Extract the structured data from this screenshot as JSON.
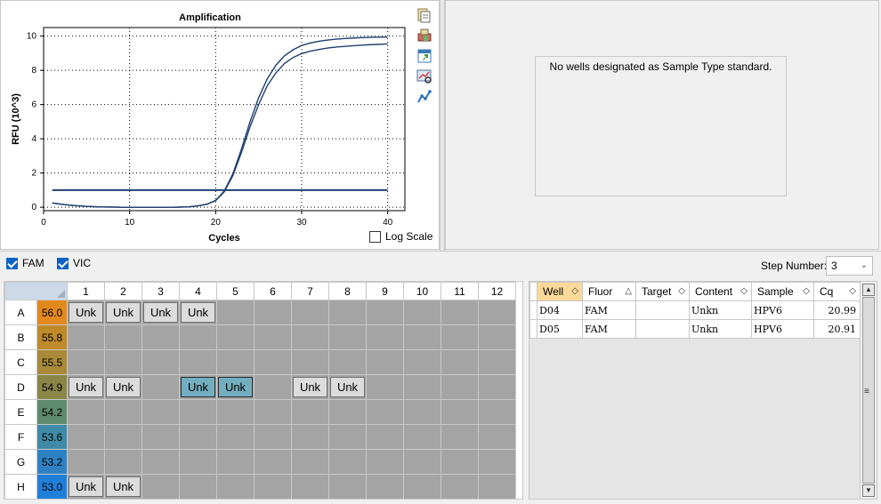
{
  "chart": {
    "toolbar_icons": [
      "copy-icon",
      "print-icon",
      "export-icon",
      "zoom-icon",
      "graph-settings-icon"
    ],
    "log_scale_label": "Log Scale",
    "log_scale_checked": false
  },
  "chart_data": {
    "type": "line",
    "title": "Amplification",
    "xlabel": "Cycles",
    "ylabel": "RFU (10^3)",
    "xlim": [
      0,
      42
    ],
    "ylim": [
      -0.2,
      10.5
    ],
    "xticks": [
      0,
      10,
      20,
      30,
      40
    ],
    "yticks": [
      0,
      2,
      4,
      6,
      8,
      10
    ],
    "grid": true,
    "line_color": "#1f3f70",
    "threshold": 1.0,
    "series": [
      {
        "well": "D04",
        "x": [
          1,
          2,
          3,
          4,
          5,
          6,
          7,
          8,
          9,
          10,
          11,
          12,
          13,
          14,
          15,
          16,
          17,
          18,
          19,
          20,
          21,
          22,
          23,
          24,
          25,
          26,
          27,
          28,
          29,
          30,
          31,
          32,
          33,
          34,
          35,
          36,
          37,
          38,
          39,
          40
        ],
        "y": [
          0.25,
          0.18,
          0.12,
          0.08,
          0.05,
          0.03,
          0.02,
          0.01,
          0.0,
          0.0,
          0.0,
          0.0,
          0.0,
          0.0,
          0.0,
          0.01,
          0.03,
          0.08,
          0.18,
          0.4,
          0.95,
          1.95,
          3.4,
          5.0,
          6.4,
          7.5,
          8.3,
          8.85,
          9.2,
          9.45,
          9.6,
          9.7,
          9.77,
          9.82,
          9.86,
          9.89,
          9.91,
          9.93,
          9.94,
          9.95
        ]
      },
      {
        "well": "D05",
        "x": [
          1,
          2,
          3,
          4,
          5,
          6,
          7,
          8,
          9,
          10,
          11,
          12,
          13,
          14,
          15,
          16,
          17,
          18,
          19,
          20,
          21,
          22,
          23,
          24,
          25,
          26,
          27,
          28,
          29,
          30,
          31,
          32,
          33,
          34,
          35,
          36,
          37,
          38,
          39,
          40
        ],
        "y": [
          0.25,
          0.18,
          0.12,
          0.08,
          0.05,
          0.03,
          0.02,
          0.01,
          0.0,
          0.0,
          0.0,
          0.0,
          0.0,
          0.0,
          0.0,
          0.01,
          0.03,
          0.08,
          0.18,
          0.38,
          0.9,
          1.85,
          3.2,
          4.7,
          6.0,
          7.1,
          7.85,
          8.4,
          8.75,
          8.98,
          9.12,
          9.22,
          9.3,
          9.36,
          9.4,
          9.44,
          9.47,
          9.5,
          9.52,
          9.54
        ]
      }
    ]
  },
  "standard_panel": {
    "message": "No wells designated as Sample Type standard."
  },
  "controls": {
    "fluors": [
      {
        "label": "FAM",
        "checked": true
      },
      {
        "label": "VIC",
        "checked": true
      }
    ],
    "step_label": "Step Number:",
    "step_value": "3"
  },
  "plate": {
    "columns": [
      "1",
      "2",
      "3",
      "4",
      "5",
      "6",
      "7",
      "8",
      "9",
      "10",
      "11",
      "12"
    ],
    "rows": [
      {
        "label": "A",
        "temp": "56.0",
        "temp_color": "#e2891e",
        "wells": [
          "Unk",
          "Unk",
          "Unk",
          "Unk",
          "",
          "",
          "",
          "",
          "",
          "",
          "",
          ""
        ]
      },
      {
        "label": "B",
        "temp": "55.8",
        "temp_color": "#bf8a2a",
        "wells": [
          "",
          "",
          "",
          "",
          "",
          "",
          "",
          "",
          "",
          "",
          "",
          ""
        ]
      },
      {
        "label": "C",
        "temp": "55.5",
        "temp_color": "#a88a38",
        "wells": [
          "",
          "",
          "",
          "",
          "",
          "",
          "",
          "",
          "",
          "",
          "",
          ""
        ]
      },
      {
        "label": "D",
        "temp": "54.9",
        "temp_color": "#8a8648",
        "wells": [
          "Unk",
          "Unk",
          "",
          "Unk",
          "Unk",
          "",
          "Unk",
          "Unk",
          "",
          "",
          "",
          ""
        ]
      },
      {
        "label": "E",
        "temp": "54.2",
        "temp_color": "#5e8a6d",
        "wells": [
          "",
          "",
          "",
          "",
          "",
          "",
          "",
          "",
          "",
          "",
          "",
          ""
        ]
      },
      {
        "label": "F",
        "temp": "53.6",
        "temp_color": "#3f8aa6",
        "wells": [
          "",
          "",
          "",
          "",
          "",
          "",
          "",
          "",
          "",
          "",
          "",
          ""
        ]
      },
      {
        "label": "G",
        "temp": "53.2",
        "temp_color": "#2e82c4",
        "wells": [
          "",
          "",
          "",
          "",
          "",
          "",
          "",
          "",
          "",
          "",
          "",
          ""
        ]
      },
      {
        "label": "H",
        "temp": "53.0",
        "temp_color": "#1f7fd8",
        "wells": [
          "Unk",
          "Unk",
          "",
          "",
          "",
          "",
          "",
          "",
          "",
          "",
          "",
          ""
        ]
      }
    ],
    "selected_wells": [
      "D4",
      "D5"
    ]
  },
  "results": {
    "headers": [
      "Well",
      "Fluor",
      "Target",
      "Content",
      "Sample",
      "Cq"
    ],
    "rows": [
      [
        "D04",
        "FAM",
        "",
        "Unkn",
        "HPV6",
        "20.99"
      ],
      [
        "D05",
        "FAM",
        "",
        "Unkn",
        "HPV6",
        "20.91"
      ]
    ]
  }
}
